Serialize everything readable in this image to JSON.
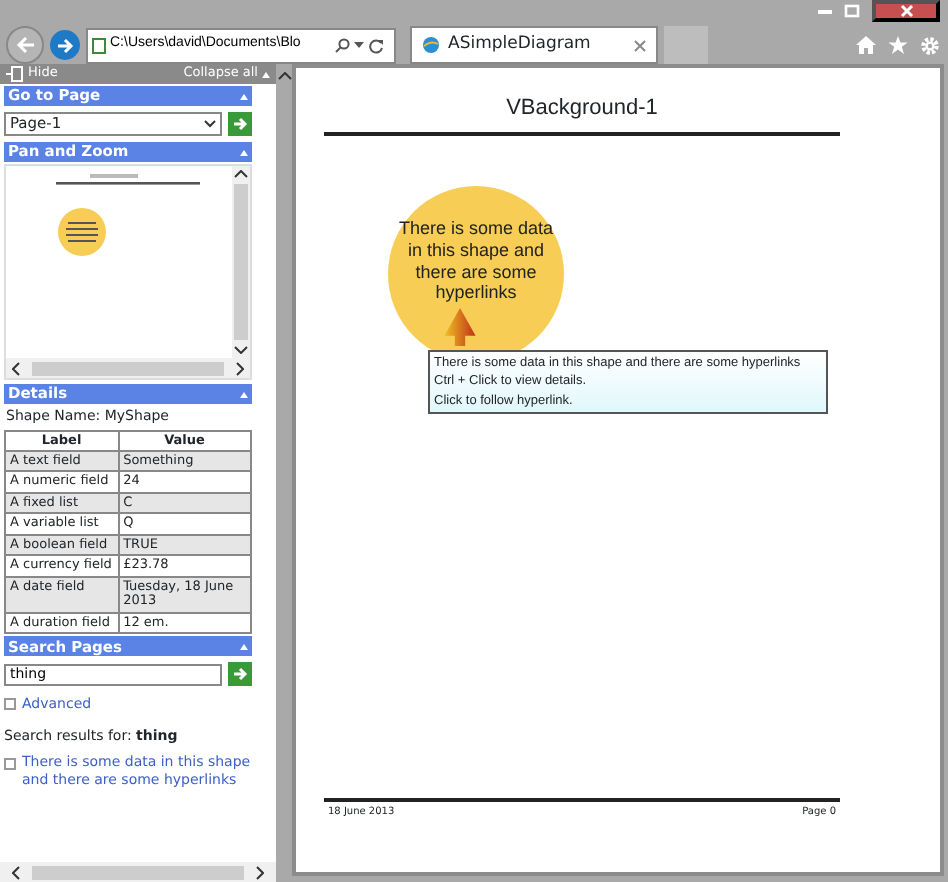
{
  "browser": {
    "address": "C:\\Users\\david\\Documents\\Blo",
    "tab": {
      "title": "ASimpleDiagram",
      "selected": true
    }
  },
  "sidebar": {
    "hide": "Hide",
    "collapse_all": "Collapse all",
    "go_to_page": {
      "title": "Go to Page",
      "value": "Page-1"
    },
    "pan_and_zoom": {
      "title": "Pan and Zoom"
    },
    "details": {
      "title": "Details",
      "shape_name": "Shape Name: MyShape",
      "columns": [
        "Label",
        "Value"
      ],
      "rows": [
        {
          "label": "A text field",
          "value": "Something",
          "shaded": true
        },
        {
          "label": "A numeric field",
          "value": "24",
          "shaded": false
        },
        {
          "label": "A fixed list",
          "value": "C",
          "shaded": true
        },
        {
          "label": "A variable list",
          "value": "Q",
          "shaded": false
        },
        {
          "label": "A boolean field",
          "value": "TRUE",
          "shaded": true
        },
        {
          "label": "A currency field",
          "value": "£23.78",
          "shaded": false
        },
        {
          "label": "A date field",
          "value": "Tuesday, 18 June 2013",
          "shaded": true
        },
        {
          "label": "A duration field",
          "value": "12 em.",
          "shaded": false
        }
      ]
    },
    "search": {
      "title": "Search Pages",
      "value": "thing",
      "advanced": "Advanced",
      "results_label": "Search results for: **thing**",
      "results": [
        "There is some data in this shape and there are some hyperlinks"
      ]
    }
  },
  "page": {
    "title": "VBackground-1",
    "shape_text": "There is some data in this shape and there are some hyperlinks",
    "tooltip": [
      "There is some data in this shape and there are some hyperlinks",
      "Ctrl + Click to view details.",
      "Click to follow hyperlink."
    ],
    "footer_date": "18 June 2013",
    "footer_page": "Page 0"
  }
}
